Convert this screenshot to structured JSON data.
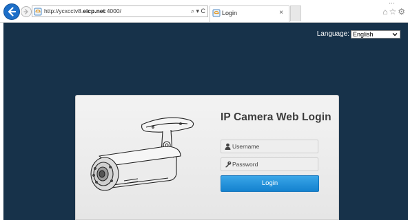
{
  "browser": {
    "url_prefix": "http://ycxcctv8.",
    "url_bold": "eicp.net",
    "url_suffix": ":4000/",
    "addr_actions": "⌕ ▾ C",
    "tab_title": "Login",
    "tab_close": "×",
    "toolbar_icons": "⌂☆⚙",
    "top_dots": "…"
  },
  "page": {
    "language_label": "Language:",
    "language_selected": "English",
    "title": "IP Camera Web Login",
    "username_placeholder": "Username",
    "password_placeholder": "Password",
    "login_label": "Login"
  },
  "colors": {
    "page_background": "#17324a",
    "login_button": "#1e8fd8",
    "browser_back": "#1c6ec8"
  }
}
